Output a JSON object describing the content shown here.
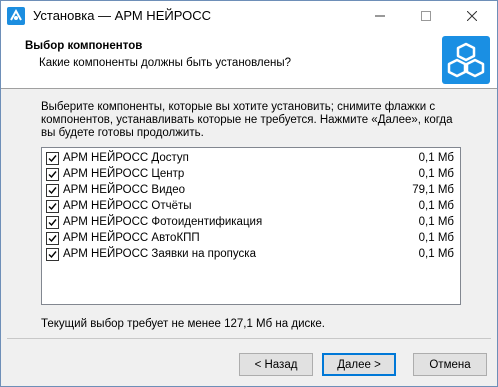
{
  "window": {
    "title": "Установка — АРМ НЕЙРОСС",
    "icons": {
      "app": "app-logo-icon",
      "minimize": "minimize-icon",
      "maximize": "maximize-icon",
      "close": "close-icon"
    }
  },
  "header": {
    "title": "Выбор компонентов",
    "subtitle": "Какие компоненты должны быть установлены?",
    "logo": "neyross-logo-icon",
    "accent_color": "#1a8fe3"
  },
  "description": {
    "line1": "Выберите компоненты, которые вы хотите установить; снимите флажки с",
    "line2": "компонентов, устанавливать которые не требуется. Нажмите «Далее», когда",
    "line3": "вы будете готовы продолжить."
  },
  "components": [
    {
      "label": "АРМ НЕЙРОСС Доступ",
      "size": "0,1 Мб",
      "checked": true
    },
    {
      "label": "АРМ НЕЙРОСС Центр",
      "size": "0,1 Мб",
      "checked": true
    },
    {
      "label": "АРМ НЕЙРОСС Видео",
      "size": "79,1 Мб",
      "checked": true
    },
    {
      "label": "АРМ НЕЙРОСС Отчёты",
      "size": "0,1 Мб",
      "checked": true
    },
    {
      "label": "АРМ НЕЙРОСС Фотоидентификация",
      "size": "0,1 Мб",
      "checked": true
    },
    {
      "label": "АРМ НЕЙРОСС АвтоКПП",
      "size": "0,1 Мб",
      "checked": true
    },
    {
      "label": "АРМ НЕЙРОСС Заявки на пропуска",
      "size": "0,1 Мб",
      "checked": true
    }
  ],
  "space_required": "Текущий выбор требует не менее 127,1 Мб на диске.",
  "buttons": {
    "back": "< Назад",
    "next": "Далее >",
    "cancel": "Отмена"
  }
}
